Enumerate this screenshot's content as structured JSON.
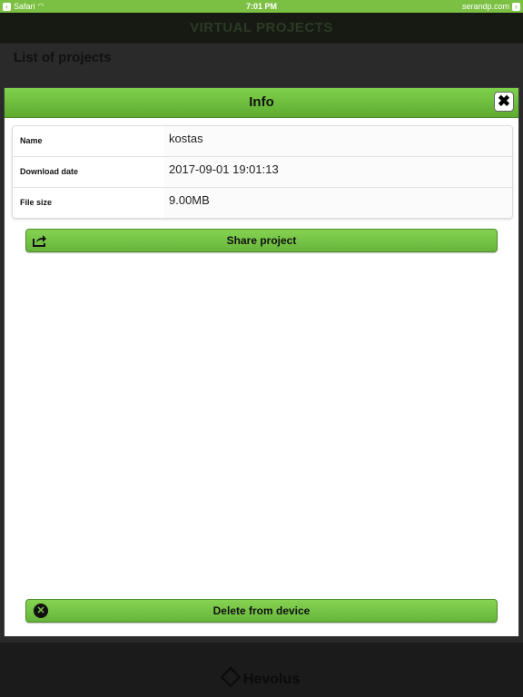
{
  "statusbar": {
    "back_app": "Safari",
    "time": "7:01 PM",
    "site": "serandp.com"
  },
  "app": {
    "title": "VIRTUAL PROJECTS",
    "list_title": "List of projects",
    "footer_brand": "Hevolus"
  },
  "modal": {
    "title": "Info",
    "close_label": "✖",
    "rows": [
      {
        "label": "Name",
        "value": "kostas"
      },
      {
        "label": "Download date",
        "value": "2017-09-01 19:01:13"
      },
      {
        "label": "File size",
        "value": "9.00MB"
      }
    ],
    "share_label": "Share project",
    "delete_label": "Delete from device"
  },
  "colors": {
    "accent": "#7cc043",
    "header_dark": "#161a13"
  }
}
